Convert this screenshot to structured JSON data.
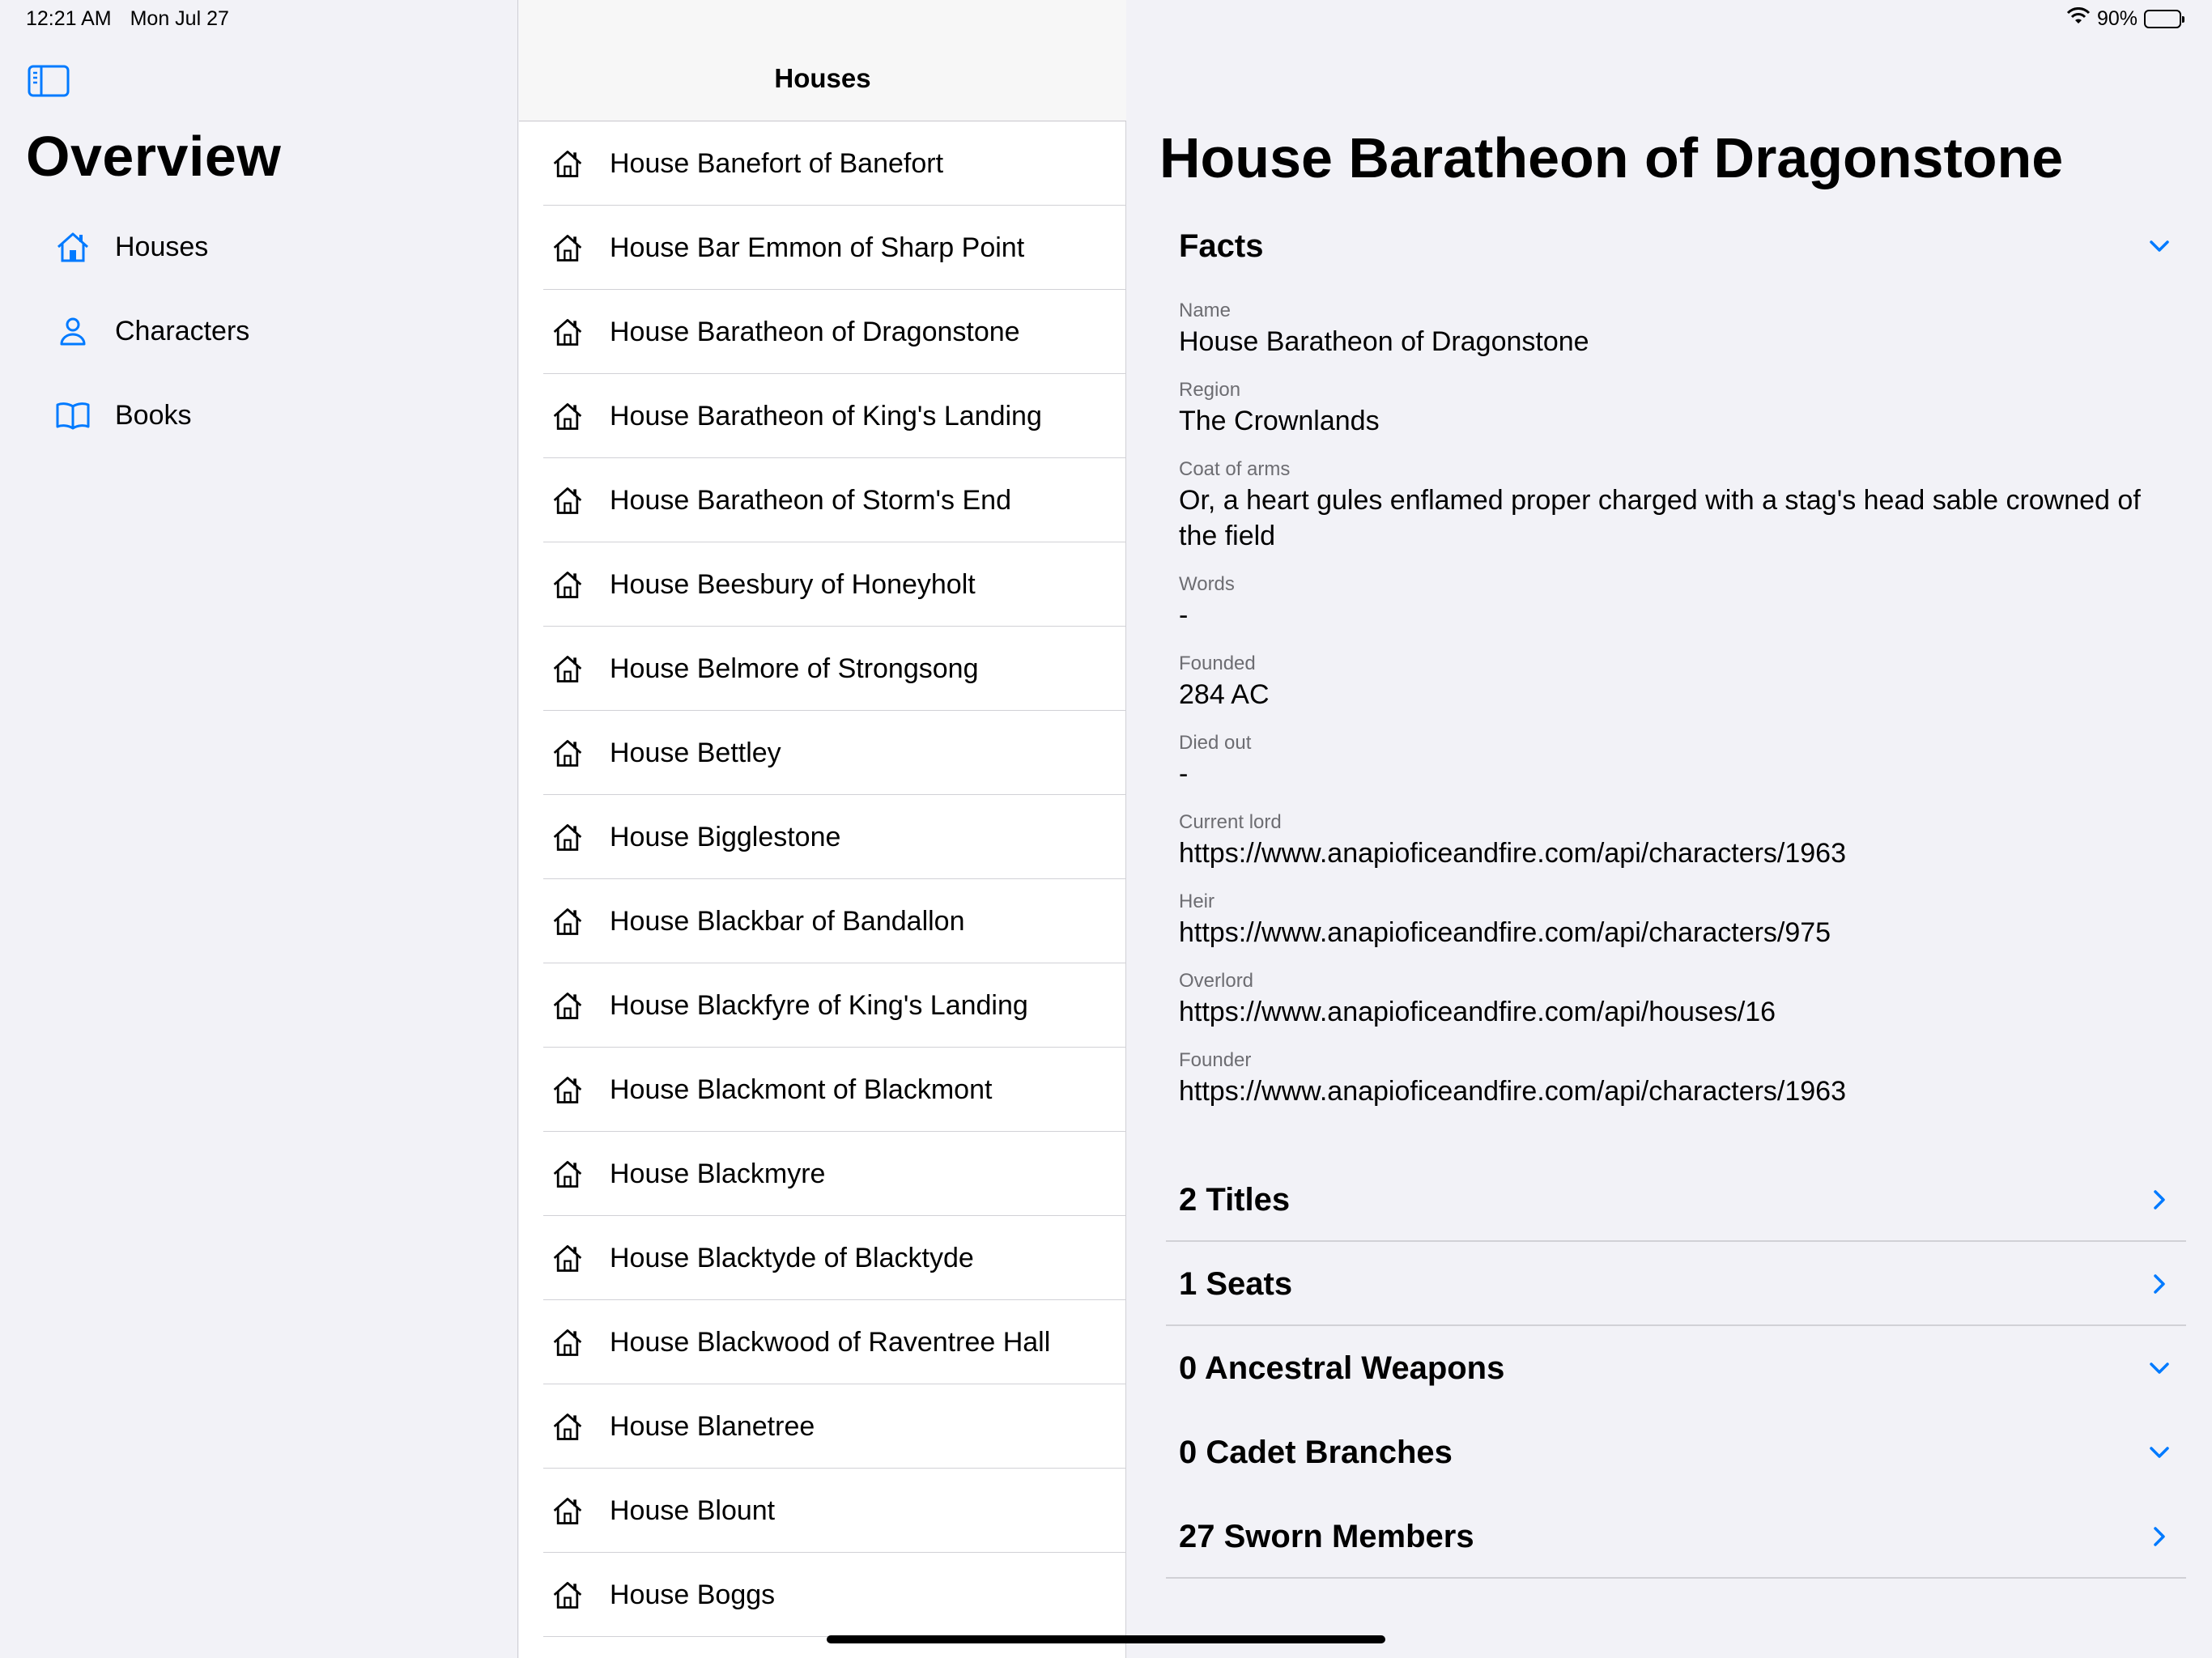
{
  "status_bar": {
    "time": "12:21 AM",
    "date": "Mon Jul 27",
    "battery": "90%"
  },
  "sidebar": {
    "title": "Overview",
    "items": [
      {
        "label": "Houses",
        "icon": "house-icon"
      },
      {
        "label": "Characters",
        "icon": "person-icon"
      },
      {
        "label": "Books",
        "icon": "book-icon"
      }
    ]
  },
  "list": {
    "title": "Houses",
    "items": [
      "House Banefort of Banefort",
      "House Bar Emmon of Sharp Point",
      "House Baratheon of Dragonstone",
      "House Baratheon of King's Landing",
      "House Baratheon of Storm's End",
      "House Beesbury of Honeyholt",
      "House Belmore of Strongsong",
      "House Bettley",
      "House Bigglestone",
      "House Blackbar of Bandallon",
      "House Blackfyre of King's Landing",
      "House Blackmont of Blackmont",
      "House Blackmyre",
      "House Blacktyde of Blacktyde",
      "House Blackwood of Raventree Hall",
      "House Blanetree",
      "House Blount",
      "House Boggs"
    ]
  },
  "detail": {
    "title": "House Baratheon of Dragonstone",
    "facts_label": "Facts",
    "facts": [
      {
        "key": "Name",
        "value": "House Baratheon of Dragonstone"
      },
      {
        "key": "Region",
        "value": "The Crownlands"
      },
      {
        "key": "Coat of arms",
        "value": "Or, a heart gules enflamed proper charged with a stag's head sable crowned of the field"
      },
      {
        "key": "Words",
        "value": "-"
      },
      {
        "key": "Founded",
        "value": "284 AC"
      },
      {
        "key": "Died out",
        "value": "-"
      },
      {
        "key": "Current lord",
        "value": "https://www.anapioficeandfire.com/api/characters/1963"
      },
      {
        "key": "Heir",
        "value": "https://www.anapioficeandfire.com/api/characters/975"
      },
      {
        "key": "Overlord",
        "value": "https://www.anapioficeandfire.com/api/houses/16"
      },
      {
        "key": "Founder",
        "value": "https://www.anapioficeandfire.com/api/characters/1963"
      }
    ],
    "sections": [
      {
        "label": "2 Titles",
        "chevron": "chevron-right-icon"
      },
      {
        "label": "1 Seats",
        "chevron": "chevron-right-icon"
      },
      {
        "label": "0 Ancestral Weapons",
        "chevron": "chevron-down-icon"
      },
      {
        "label": "0 Cadet Branches",
        "chevron": "chevron-down-icon"
      },
      {
        "label": "27 Sworn Members",
        "chevron": "chevron-right-icon"
      }
    ]
  },
  "colors": {
    "accent": "#007aff",
    "background": "#f2f2f7",
    "separator": "#d1d1d6"
  }
}
